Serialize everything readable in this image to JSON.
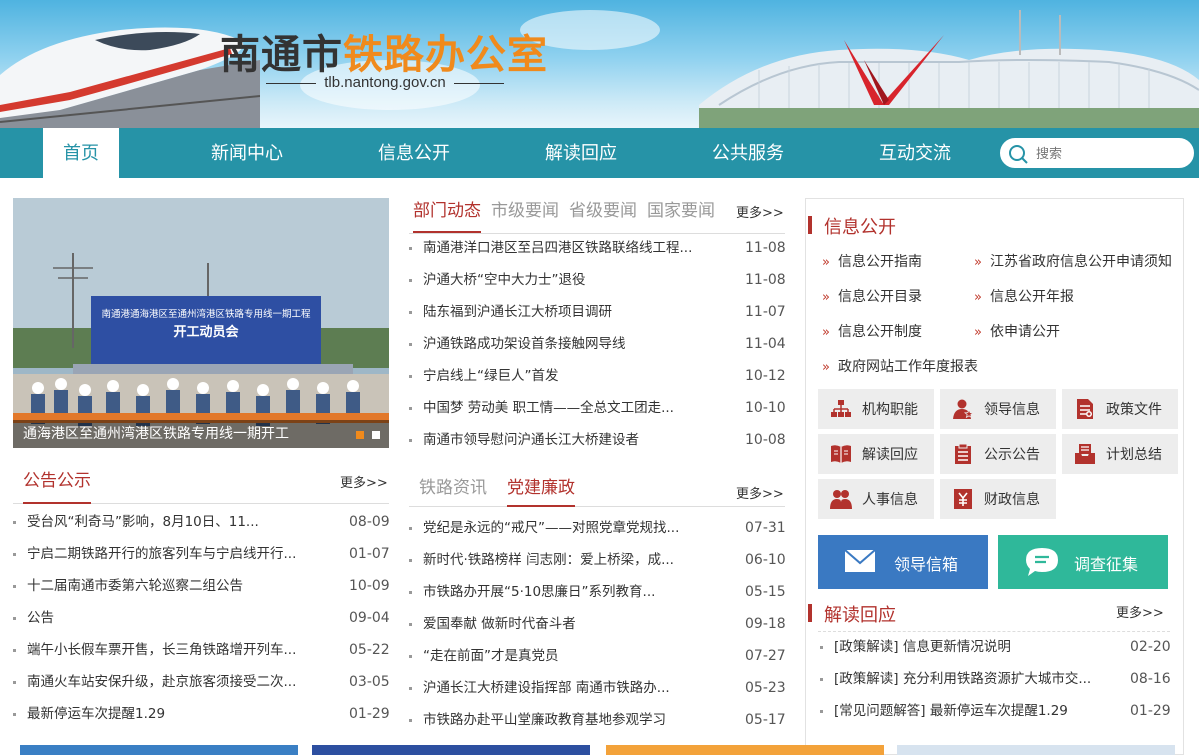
{
  "header": {
    "title_part1": "南通市",
    "title_part2": "铁路办公室",
    "domain": "tlb.nantong.gov.cn"
  },
  "nav": {
    "items": [
      "首页",
      "新闻中心",
      "信息公开",
      "解读回应",
      "公共服务",
      "互动交流"
    ],
    "search_placeholder": "搜索"
  },
  "slider": {
    "banner_title": "南通港通海港区至通州湾港区铁路专用线一期工程",
    "banner_subtitle": "开工动员会",
    "caption": "通海港区至通州湾港区铁路专用线一期开工"
  },
  "news": {
    "tabs": [
      "部门动态",
      "市级要闻",
      "省级要闻",
      "国家要闻"
    ],
    "more": "更多>>",
    "items": [
      {
        "title": "南通港洋口港区至吕四港区铁路联络线工程...",
        "date": "11-08"
      },
      {
        "title": "沪通大桥“空中大力士”退役",
        "date": "11-08"
      },
      {
        "title": "陆东福到沪通长江大桥项目调研",
        "date": "11-07"
      },
      {
        "title": "沪通铁路成功架设首条接触网导线",
        "date": "11-04"
      },
      {
        "title": "宁启线上“绿巨人”首发",
        "date": "10-12"
      },
      {
        "title": "中国梦 劳动美 职工情——全总文工团走...",
        "date": "10-10"
      },
      {
        "title": "南通市领导慰问沪通长江大桥建设者",
        "date": "10-08"
      }
    ]
  },
  "notice": {
    "title": "公告公示",
    "more": "更多>>",
    "items": [
      {
        "title": "受台风“利奇马”影响，8月10日、11...",
        "date": "08-09"
      },
      {
        "title": "宁启二期铁路开行的旅客列车与宁启线开行...",
        "date": "01-07"
      },
      {
        "title": "十二届南通市委第六轮巡察二组公告",
        "date": "10-09"
      },
      {
        "title": "公告",
        "date": "09-04"
      },
      {
        "title": "端午小长假车票开售，长三角铁路增开列车...",
        "date": "05-22"
      },
      {
        "title": "南通火车站安保升级，赴京旅客须接受二次...",
        "date": "03-05"
      },
      {
        "title": "最新停运车次提醒1.29",
        "date": "01-29"
      }
    ]
  },
  "party": {
    "tabs": [
      "铁路资讯",
      "党建廉政"
    ],
    "more": "更多>>",
    "items": [
      {
        "title": "党纪是永远的“戒尺”——对照党章党规找...",
        "date": "07-31"
      },
      {
        "title": "新时代·铁路榜样 闫志刚：爱上桥梁，成...",
        "date": "06-10"
      },
      {
        "title": "市铁路办开展“5·10思廉日”系列教育...",
        "date": "05-15"
      },
      {
        "title": "爱国奉献 做新时代奋斗者",
        "date": "09-18"
      },
      {
        "title": "“走在前面”才是真党员",
        "date": "07-27"
      },
      {
        "title": "沪通长江大桥建设指挥部 南通市铁路办...",
        "date": "05-23"
      },
      {
        "title": "市铁路办赴平山堂廉政教育基地参观学习",
        "date": "05-17"
      }
    ]
  },
  "info": {
    "title": "信息公开",
    "links": [
      "信息公开指南",
      "江苏省政府信息公开申请须知",
      "信息公开目录",
      "信息公开年报",
      "信息公开制度",
      "依申请公开",
      "政府网站工作年度报表"
    ],
    "tiles": [
      {
        "label": "机构职能",
        "icon": "org-chart-icon"
      },
      {
        "label": "领导信息",
        "icon": "leader-icon"
      },
      {
        "label": "政策文件",
        "icon": "document-icon"
      },
      {
        "label": "解读回应",
        "icon": "book-icon"
      },
      {
        "label": "公示公告",
        "icon": "notice-board-icon"
      },
      {
        "label": "计划总结",
        "icon": "inbox-icon"
      },
      {
        "label": "人事信息",
        "icon": "people-icon"
      },
      {
        "label": "财政信息",
        "icon": "yuan-icon"
      }
    ],
    "mailbox": "领导信箱",
    "survey": "调查征集"
  },
  "reply": {
    "title": "解读回应",
    "more": "更多>>",
    "items": [
      {
        "title": "[政策解读] 信息更新情况说明",
        "date": "02-20"
      },
      {
        "title": "[政策解读] 充分利用铁路资源扩大城市交...",
        "date": "08-16"
      },
      {
        "title": "[常见问题解答] 最新停运车次提醒1.29",
        "date": "01-29"
      }
    ]
  },
  "colors": {
    "nav": "#2693a7",
    "accent": "#b2322d",
    "orange": "#f08a1c",
    "mailbox": "#3a79c2",
    "survey": "#2fb89a"
  }
}
